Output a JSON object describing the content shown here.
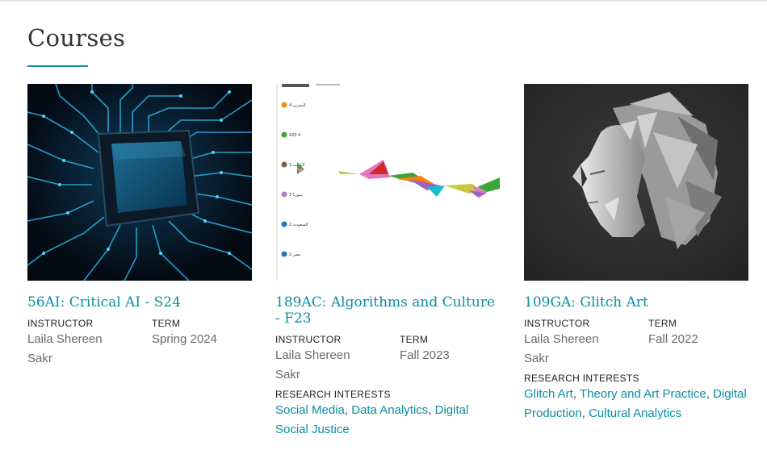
{
  "page": {
    "title": "Courses"
  },
  "labels": {
    "instructor": "INSTRUCTOR",
    "term": "TERM",
    "research": "RESEARCH INTERESTS"
  },
  "colors": {
    "accent": "#0b8ea2",
    "text": "#6a6a6a"
  },
  "courses": [
    {
      "title": "56AI: Critical AI - S24",
      "instructor": "Laila Shereen Sakr",
      "term": "Spring 2024",
      "image": "ai-chip-circuit-board",
      "interests": []
    },
    {
      "title": "189AC: Algorithms and Culture - F23",
      "instructor": "Laila Shereen Sakr",
      "term": "Fall 2023",
      "image": "data-visualization-chart",
      "interests": [
        "Social Media",
        "Data Analytics",
        "Digital Social Justice"
      ],
      "chart_legend": [
        "البحرين 4",
        "420 4",
        "3 الكويت",
        "3 سوريا",
        "2 السعودية",
        "2 مصر"
      ]
    },
    {
      "title": "109GA: Glitch Art",
      "instructor": "Laila Shereen Sakr",
      "term": "Fall 2022",
      "image": "glitch-face-sculpture",
      "interests": [
        "Glitch Art",
        "Theory and Art Practice",
        "Digital Production",
        "Cultural Analytics"
      ]
    }
  ]
}
